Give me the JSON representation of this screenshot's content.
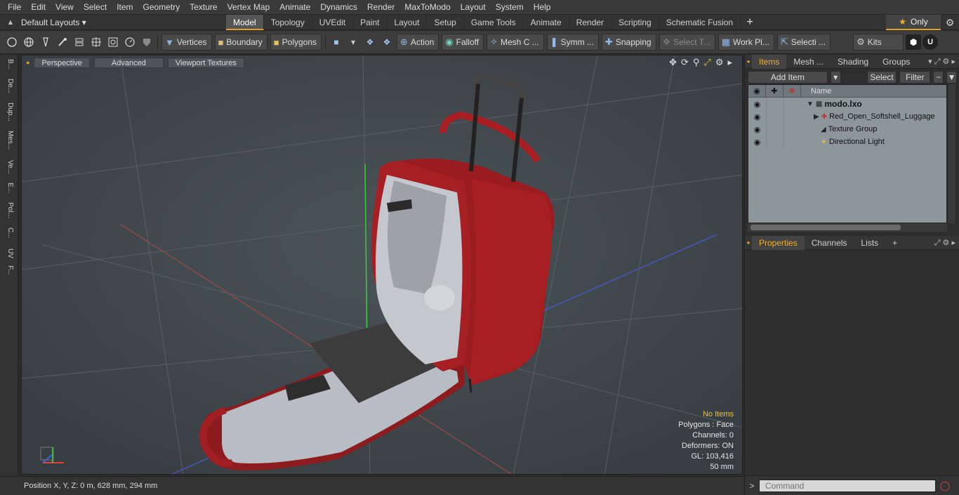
{
  "menubar": [
    "File",
    "Edit",
    "View",
    "Select",
    "Item",
    "Geometry",
    "Texture",
    "Vertex Map",
    "Animate",
    "Dynamics",
    "Render",
    "MaxToModo",
    "Layout",
    "System",
    "Help"
  ],
  "layoutbar": {
    "layout_select": "Default Layouts ▾",
    "tabs": [
      "Model",
      "Topology",
      "UVEdit",
      "Paint",
      "Layout",
      "Setup",
      "Game Tools",
      "Animate",
      "Render",
      "Scripting",
      "Schematic Fusion"
    ],
    "active_tab": "Model",
    "only_label": "Only"
  },
  "toolbar": {
    "vertices": "Vertices",
    "boundary": "Boundary",
    "polygons": "Polygons",
    "action": "Action",
    "falloff": "Falloff",
    "mesh": "Mesh C ...",
    "symmetry": "Symm ...",
    "snapping": "Snapping",
    "select_t": "Select T...",
    "work_plane": "Work Pl...",
    "selection": "Selecti ...",
    "kits": "Kits"
  },
  "leftstrip": [
    "B...",
    "De...",
    "Dup...",
    "Mes...",
    "Ve...",
    "E...",
    "Pol...",
    "C...",
    "UV",
    "F..."
  ],
  "viewport": {
    "perspective": "Perspective",
    "advanced": "Advanced",
    "textures": "Viewport Textures",
    "stats": {
      "no_items": "No Items",
      "polygons": "Polygons : Face",
      "channels": "Channels: 0",
      "deformers": "Deformers: ON",
      "gl": "GL: 103,416",
      "scale": "50 mm"
    }
  },
  "statusbar": {
    "position": "Position X, Y, Z:   0 m, 628 mm, 294 mm"
  },
  "items_panel": {
    "tabs": [
      "Items",
      "Mesh ...",
      "Shading",
      "Groups"
    ],
    "add_item": "Add Item",
    "select": "Select",
    "filter": "Filter",
    "column_name": "Name",
    "rows": [
      {
        "name": "modo.lxo"
      },
      {
        "name": "Red_Open_Softshell_Luggage"
      },
      {
        "name": "Texture Group"
      },
      {
        "name": "Directional Light"
      }
    ]
  },
  "props_panel": {
    "tabs": [
      "Properties",
      "Channels",
      "Lists"
    ]
  },
  "command": {
    "placeholder": "Command"
  }
}
